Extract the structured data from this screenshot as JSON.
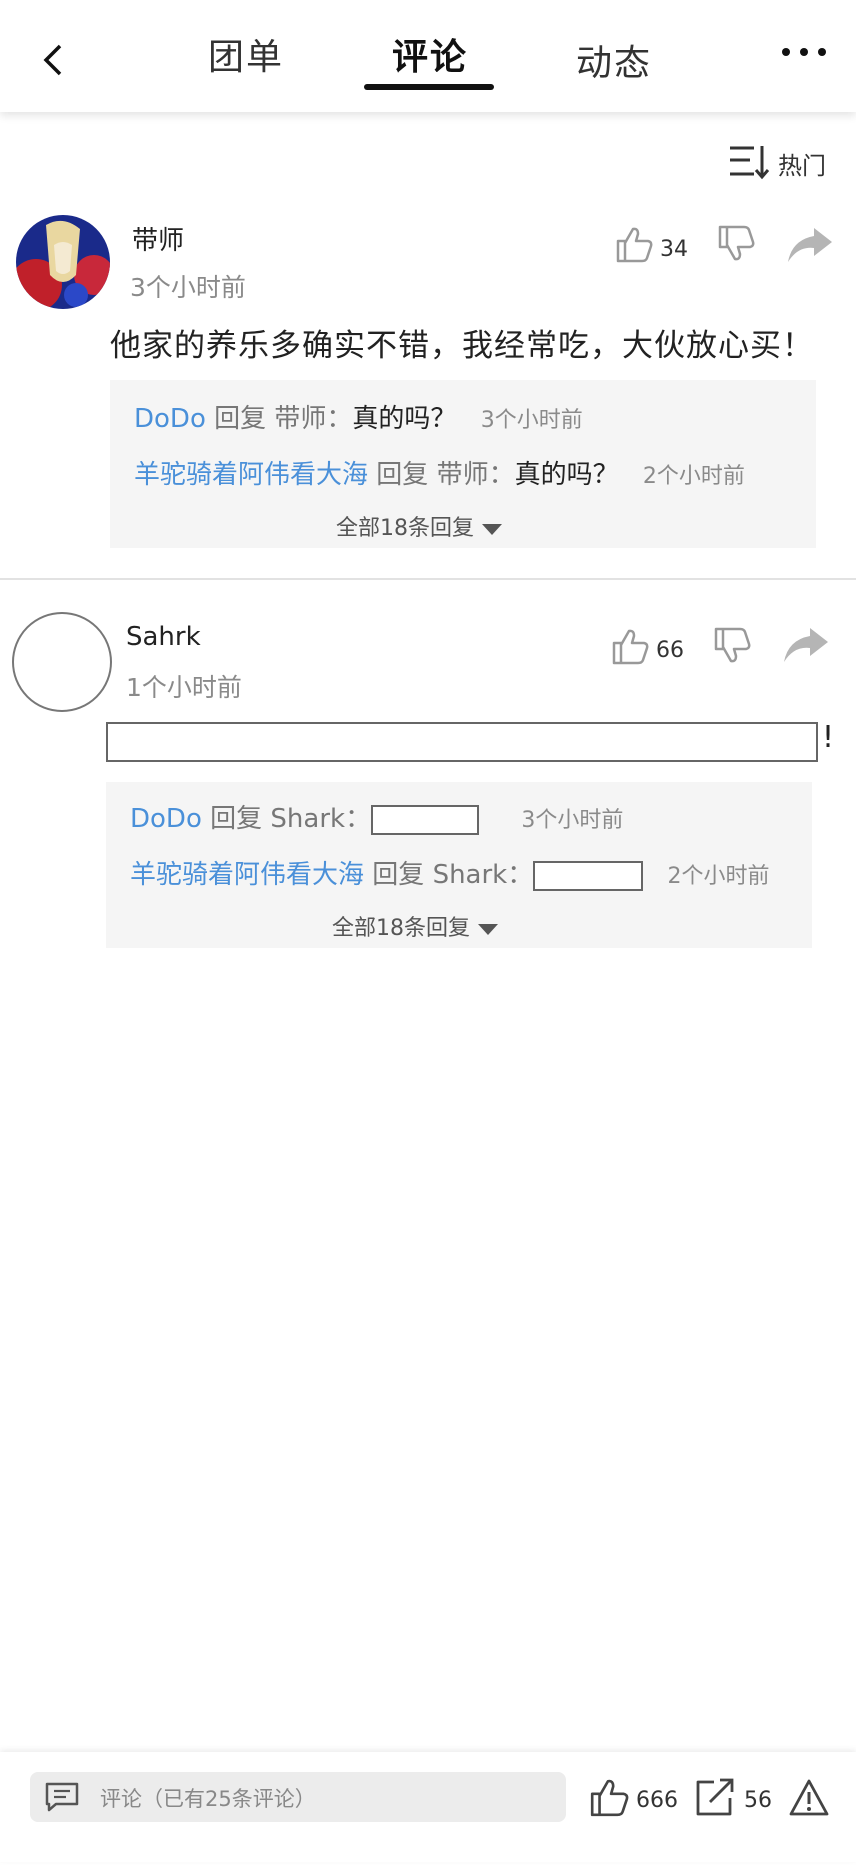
{
  "header": {
    "tabs": [
      {
        "label": "团单",
        "active": false
      },
      {
        "label": "评论",
        "active": true
      },
      {
        "label": "动态",
        "active": false
      }
    ]
  },
  "sort": {
    "label": "热门"
  },
  "comments": [
    {
      "username": "带师",
      "time": "3个小时前",
      "likes": "34",
      "text": "他家的养乐多确实不错，我经常吃，大伙放心买！",
      "replies": [
        {
          "name": "DoDo",
          "connector": "回复",
          "target": "带师：",
          "text": "真的吗？",
          "time": "3个小时前"
        },
        {
          "name": "羊驼骑着阿伟看大海",
          "connector": "回复",
          "target": "带师：",
          "text": "真的吗？",
          "time": "2个小时前"
        }
      ],
      "all_replies": "全部18条回复"
    },
    {
      "username": "Sahrk",
      "time": "1个小时前",
      "likes": "66",
      "text_suffix": "!",
      "replies": [
        {
          "name": "DoDo",
          "connector": "回复",
          "target": "Shark：",
          "time": "3个小时前"
        },
        {
          "name": "羊驼骑着阿伟看大海",
          "connector": "回复",
          "target": "Shark：",
          "time": "2个小时前"
        }
      ],
      "all_replies": "全部18条回复"
    }
  ],
  "bottom": {
    "placeholder": "评论（已有25条评论）",
    "likes": "666",
    "shares": "56"
  },
  "colors": {
    "link": "#4a90d9",
    "muted": "#8a8a8a",
    "reply_bg": "#f5f5f5"
  }
}
